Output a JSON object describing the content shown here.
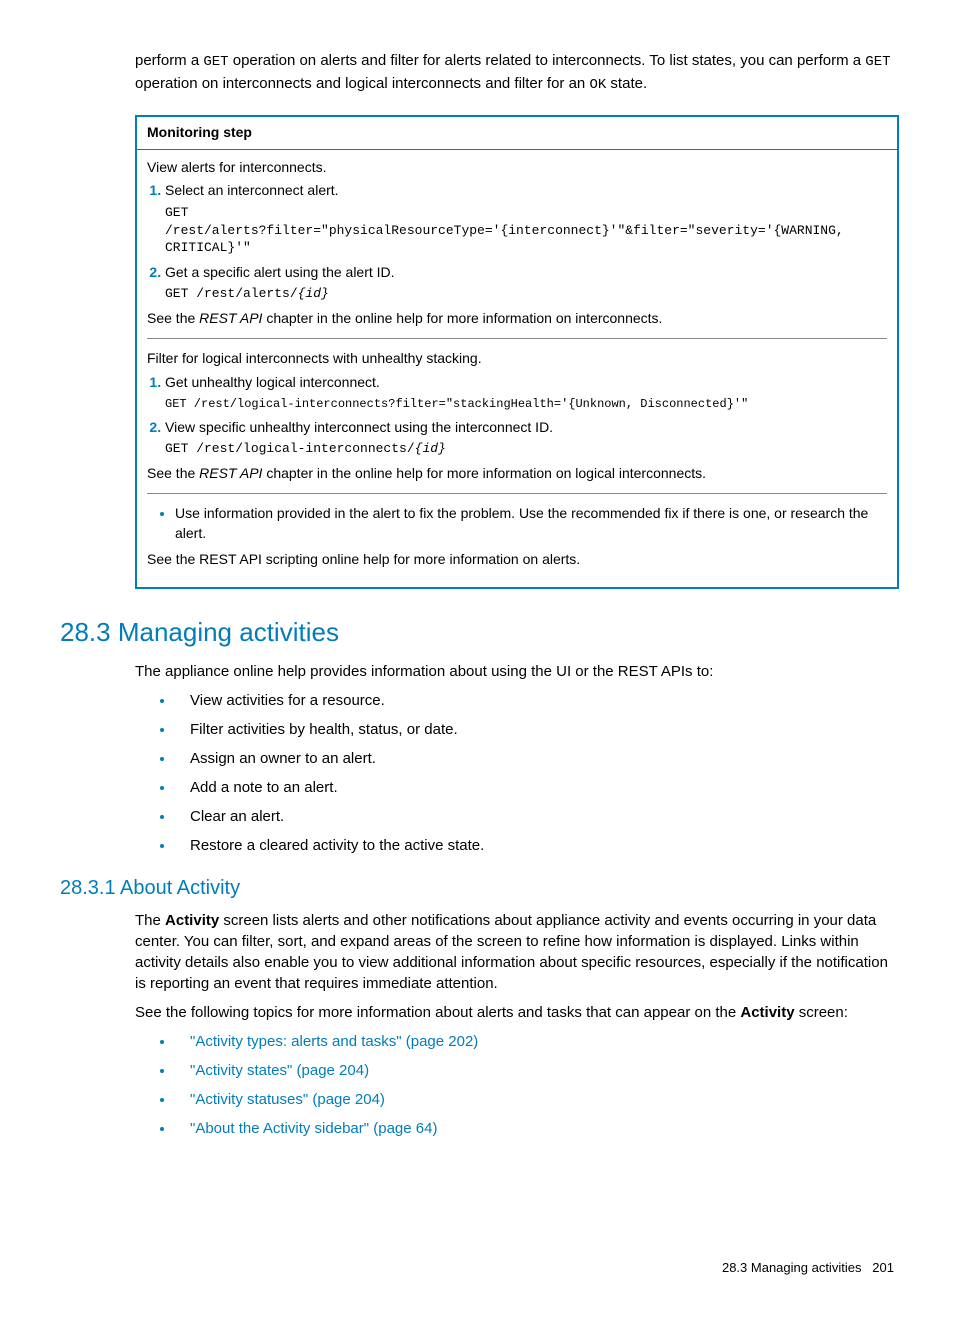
{
  "intro": {
    "prefix": "perform a ",
    "code1": "GET",
    "mid1": " operation on alerts and filter for alerts related to interconnects. To list states, you can perform a ",
    "code2": "GET",
    "mid2": " operation on interconnects and logical interconnects and filter for an ",
    "code3": "OK",
    "suffix": " state."
  },
  "monitor": {
    "header": "Monitoring step",
    "section1": {
      "intro": "View alerts for interconnects.",
      "item1_text": "Select an interconnect alert.",
      "item1_code_l1": "GET",
      "item1_code_l2": "/rest/alerts?filter=\"physicalResourceType='{interconnect}'\"&filter=\"severity='{WARNING,",
      "item1_code_l3": "CRITICAL}'\"",
      "item2_text": "Get a specific alert using the alert ID.",
      "item2_code": "GET /rest/alerts/",
      "item2_code_italic": "{id}",
      "see_prefix": "See the ",
      "see_italic": "REST API",
      "see_suffix": " chapter in the online help for more information on interconnects."
    },
    "section2": {
      "intro": "Filter for logical interconnects with unhealthy stacking.",
      "item1_text": "Get unhealthy logical interconnect.",
      "item1_code": "GET /rest/logical-interconnects?filter=\"stackingHealth='{Unknown, Disconnected}'\"",
      "item2_text": "View specific unhealthy interconnect using the interconnect ID.",
      "item2_code": "GET /rest/logical-interconnects/",
      "item2_code_italic": "{id}",
      "see_prefix": "See the ",
      "see_italic": "REST API",
      "see_suffix": " chapter in the online help for more information on logical interconnects."
    },
    "section3": {
      "bullet": "Use information provided in the alert to fix the problem. Use the recommended fix if there is one, or research the alert.",
      "see": "See the REST API scripting online help for more information on alerts."
    }
  },
  "heading283": "28.3 Managing activities",
  "body283_intro": "The appliance online help provides information about using the UI or the REST APIs to:",
  "bullets283": {
    "b1": "View activities for a resource.",
    "b2": "Filter activities by health, status, or date.",
    "b3": "Assign an owner to an alert.",
    "b4": "Add a note to an alert.",
    "b5": "Clear an alert.",
    "b6": "Restore a cleared activity to the active state."
  },
  "heading2831": "28.3.1 About Activity",
  "body2831_p1_prefix": "The ",
  "body2831_p1_bold1": "Activity",
  "body2831_p1_mid": " screen lists alerts and other notifications about appliance activity and events occurring in your data center. You can filter, sort, and expand areas of the screen to refine how information is displayed. Links within activity details also enable you to view additional information about specific resources, especially if the notification is reporting an event that requires immediate attention.",
  "body2831_p2_prefix": "See the following topics for more information about alerts and tasks that can appear on the ",
  "body2831_p2_bold": "Activity",
  "body2831_p2_suffix": " screen:",
  "links2831": {
    "l1": "\"Activity types: alerts and tasks\" (page 202)",
    "l2": "\"Activity states\" (page 204)",
    "l3": "\"Activity statuses\" (page 204)",
    "l4": "\"About the Activity sidebar\" (page 64)"
  },
  "footer": {
    "text": "28.3 Managing activities",
    "page": "201"
  }
}
